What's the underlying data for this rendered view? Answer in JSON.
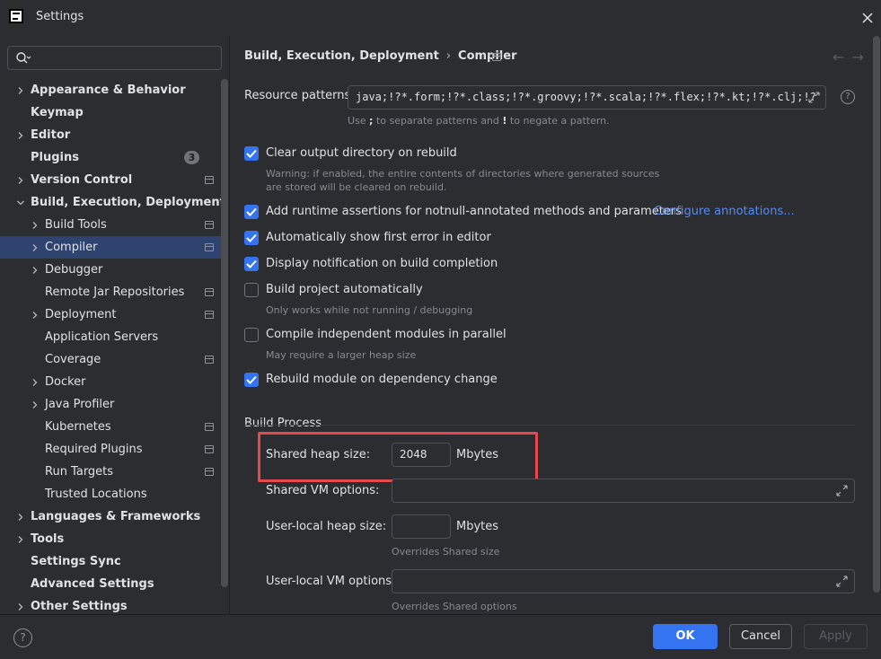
{
  "window": {
    "title": "Settings"
  },
  "search": {
    "placeholder": ""
  },
  "sidebar": {
    "items": [
      {
        "label": "Appearance & Behavior",
        "bold": true,
        "chevron": true,
        "indent": 0
      },
      {
        "label": "Keymap",
        "bold": true,
        "chevron": false,
        "indent": 0
      },
      {
        "label": "Editor",
        "bold": true,
        "chevron": true,
        "indent": 0
      },
      {
        "label": "Plugins",
        "bold": true,
        "chevron": false,
        "indent": 0,
        "badge": "3"
      },
      {
        "label": "Version Control",
        "bold": true,
        "chevron": true,
        "indent": 0,
        "project": true
      },
      {
        "label": "Build, Execution, Deployment",
        "bold": true,
        "chevron": "down",
        "indent": 0
      },
      {
        "label": "Build Tools",
        "bold": false,
        "chevron": true,
        "indent": 1,
        "project": true
      },
      {
        "label": "Compiler",
        "bold": false,
        "chevron": true,
        "indent": 1,
        "project": true,
        "selected": true
      },
      {
        "label": "Debugger",
        "bold": false,
        "chevron": true,
        "indent": 1
      },
      {
        "label": "Remote Jar Repositories",
        "bold": false,
        "chevron": false,
        "indent": 1,
        "project": true
      },
      {
        "label": "Deployment",
        "bold": false,
        "chevron": true,
        "indent": 1,
        "project": true
      },
      {
        "label": "Application Servers",
        "bold": false,
        "chevron": false,
        "indent": 1
      },
      {
        "label": "Coverage",
        "bold": false,
        "chevron": false,
        "indent": 1,
        "project": true
      },
      {
        "label": "Docker",
        "bold": false,
        "chevron": true,
        "indent": 1
      },
      {
        "label": "Java Profiler",
        "bold": false,
        "chevron": true,
        "indent": 1
      },
      {
        "label": "Kubernetes",
        "bold": false,
        "chevron": false,
        "indent": 1,
        "project": true
      },
      {
        "label": "Required Plugins",
        "bold": false,
        "chevron": false,
        "indent": 1,
        "project": true
      },
      {
        "label": "Run Targets",
        "bold": false,
        "chevron": false,
        "indent": 1,
        "project": true
      },
      {
        "label": "Trusted Locations",
        "bold": false,
        "chevron": false,
        "indent": 1
      },
      {
        "label": "Languages & Frameworks",
        "bold": true,
        "chevron": true,
        "indent": 0
      },
      {
        "label": "Tools",
        "bold": true,
        "chevron": true,
        "indent": 0
      },
      {
        "label": "Settings Sync",
        "bold": true,
        "chevron": false,
        "indent": 0
      },
      {
        "label": "Advanced Settings",
        "bold": true,
        "chevron": false,
        "indent": 0
      },
      {
        "label": "Other Settings",
        "bold": true,
        "chevron": true,
        "indent": 0
      }
    ]
  },
  "breadcrumb": {
    "parent": "Build, Execution, Deployment",
    "separator": "›",
    "current": "Compiler"
  },
  "nav": {
    "back": "←",
    "forward": "→"
  },
  "resource_patterns": {
    "label": "Resource patterns:",
    "value": "java;!?*.form;!?*.class;!?*.groovy;!?*.scala;!?*.flex;!?*.kt;!?*.clj;!?",
    "hint_pre": "Use ",
    "hint_sep": ";",
    "hint_mid": " to separate patterns and ",
    "hint_neg": "!",
    "hint_post": " to negate a pattern."
  },
  "options": {
    "clear_output": {
      "label": "Clear output directory on rebuild",
      "checked": true,
      "hint1": "Warning: if enabled, the entire contents of directories where generated sources",
      "hint2": "are stored will be cleared on rebuild."
    },
    "runtime_assertions": {
      "label": "Add runtime assertions for notnull-annotated methods and parameters",
      "checked": true,
      "link": "Configure annotations..."
    },
    "show_first_error": {
      "label": "Automatically show first error in editor",
      "checked": true
    },
    "display_notification": {
      "label": "Display notification on build completion",
      "checked": true
    },
    "build_automatically": {
      "label": "Build project automatically",
      "checked": false,
      "hint": "Only works while not running / debugging"
    },
    "compile_parallel": {
      "label": "Compile independent modules in parallel",
      "checked": false,
      "hint": "May require a larger heap size"
    },
    "rebuild_on_dependency": {
      "label": "Rebuild module on dependency change",
      "checked": true
    }
  },
  "build_process": {
    "title": "Build Process",
    "shared_heap": {
      "label": "Shared heap size:",
      "value": "2048",
      "unit": "Mbytes"
    },
    "shared_vm": {
      "label": "Shared VM options:",
      "value": ""
    },
    "user_heap": {
      "label": "User-local heap size:",
      "value": "",
      "unit": "Mbytes",
      "hint": "Overrides Shared size"
    },
    "user_vm": {
      "label": "User-local VM options:",
      "value": "",
      "hint": "Overrides Shared options"
    }
  },
  "footer": {
    "help": "?",
    "ok": "OK",
    "cancel": "Cancel",
    "apply": "Apply"
  },
  "colors": {
    "accent": "#3574f0",
    "selection": "#2e436e",
    "highlight": "#e5484d",
    "link": "#548af7"
  }
}
